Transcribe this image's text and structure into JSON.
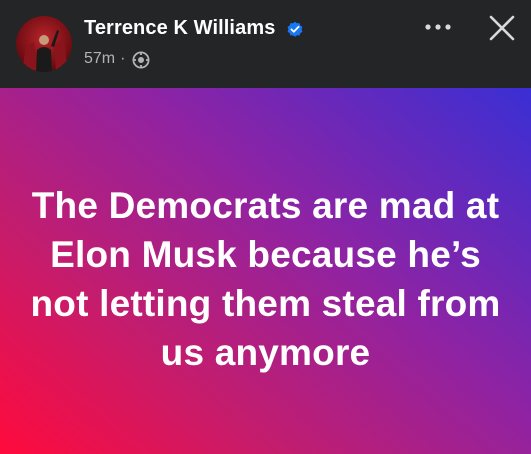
{
  "post": {
    "author": "Terrence K Williams",
    "time": "57m",
    "separator": "·",
    "audience_icon": "globe-icon",
    "verified_icon": "verified-badge-icon",
    "text": "The Democrats are mad at Elon Musk because he’s not letting them steal from us anymore"
  },
  "actions": {
    "more_icon": "more-options-icon",
    "close_icon": "close-icon"
  },
  "colors": {
    "header_bg": "#242526",
    "name": "#ffffff",
    "meta": "#b0b3b8",
    "verified": "#1877f2",
    "gradient": [
      "#ff0a3c",
      "#c21d6f",
      "#8e23a4",
      "#3a2fd4"
    ]
  }
}
